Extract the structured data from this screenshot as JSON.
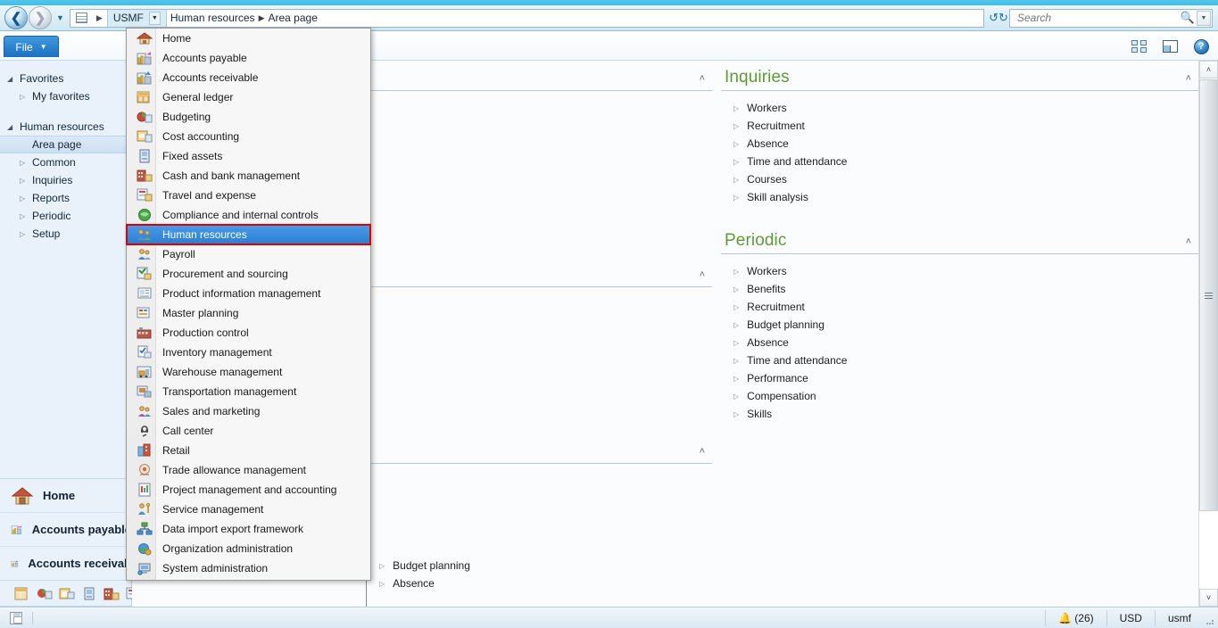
{
  "titlebar": {
    "color": "#3fbde5"
  },
  "addressbar": {
    "company": "USMF",
    "breadcrumb": [
      "Human resources",
      "Area page"
    ],
    "separator": "▶",
    "back_arrow": "❮",
    "forward_arrow": "❯",
    "recent_caret": "▼",
    "refresh_icon": "refresh-icon",
    "grid_icon": "grid-icon"
  },
  "search": {
    "placeholder": "Search",
    "value": "",
    "magnifier": "⚲",
    "caret": "▼"
  },
  "ribbon": {
    "file_label": "File",
    "file_caret": "▼",
    "right_icons": [
      "layouts-icon",
      "pane-layout-icon",
      "help-icon"
    ],
    "help_glyph": "?"
  },
  "sidebar": {
    "groups": [
      {
        "name": "Favorites",
        "expander": "◢",
        "items": [
          {
            "label": "My favorites",
            "expander": "▷"
          }
        ]
      },
      {
        "name": "Human resources",
        "expander": "◢",
        "items": [
          {
            "label": "Area page",
            "expander": "",
            "selected": true
          },
          {
            "label": "Common",
            "expander": "▷"
          },
          {
            "label": "Inquiries",
            "expander": "▷"
          },
          {
            "label": "Reports",
            "expander": "▷"
          },
          {
            "label": "Periodic",
            "expander": "▷"
          },
          {
            "label": "Setup",
            "expander": "▷"
          }
        ]
      }
    ],
    "places": [
      {
        "label": "Home",
        "icon": "home-icon"
      },
      {
        "label": "Accounts payable",
        "icon": "accounts-payable-icon"
      },
      {
        "label": "Accounts receivab",
        "icon": "accounts-receivable-icon"
      }
    ],
    "mini_icons": [
      "general-ledger-icon",
      "budgeting-icon",
      "cost-accounting-icon",
      "fixed-assets-icon",
      "cash-bank-icon",
      "travel-expense-icon",
      "compliance-icon",
      "human-resources-icon"
    ],
    "mini_more": "»"
  },
  "module_menu": {
    "items": [
      {
        "label": "Home",
        "icon": "home-icon"
      },
      {
        "label": "Accounts payable",
        "icon": "accounts-payable-icon"
      },
      {
        "label": "Accounts receivable",
        "icon": "accounts-receivable-icon"
      },
      {
        "label": "General ledger",
        "icon": "general-ledger-icon"
      },
      {
        "label": "Budgeting",
        "icon": "budgeting-icon"
      },
      {
        "label": "Cost accounting",
        "icon": "cost-accounting-icon"
      },
      {
        "label": "Fixed assets",
        "icon": "fixed-assets-icon"
      },
      {
        "label": "Cash and bank management",
        "icon": "cash-bank-icon"
      },
      {
        "label": "Travel and expense",
        "icon": "travel-expense-icon"
      },
      {
        "label": "Compliance and internal controls",
        "icon": "compliance-icon"
      },
      {
        "label": "Human resources",
        "icon": "human-resources-icon",
        "active": true
      },
      {
        "label": "Payroll",
        "icon": "payroll-icon"
      },
      {
        "label": "Procurement and sourcing",
        "icon": "procurement-icon"
      },
      {
        "label": "Product information management",
        "icon": "product-info-icon"
      },
      {
        "label": "Master planning",
        "icon": "master-planning-icon"
      },
      {
        "label": "Production control",
        "icon": "production-control-icon"
      },
      {
        "label": "Inventory management",
        "icon": "inventory-icon"
      },
      {
        "label": "Warehouse management",
        "icon": "warehouse-icon"
      },
      {
        "label": "Transportation management",
        "icon": "transportation-icon"
      },
      {
        "label": "Sales and marketing",
        "icon": "sales-marketing-icon"
      },
      {
        "label": "Call center",
        "icon": "call-center-icon"
      },
      {
        "label": "Retail",
        "icon": "retail-icon"
      },
      {
        "label": "Trade allowance management",
        "icon": "trade-allowance-icon"
      },
      {
        "label": "Project management and accounting",
        "icon": "project-management-icon"
      },
      {
        "label": "Service management",
        "icon": "service-management-icon"
      },
      {
        "label": "Data import export framework",
        "icon": "data-import-export-icon"
      },
      {
        "label": "Organization administration",
        "icon": "organization-admin-icon"
      },
      {
        "label": "System administration",
        "icon": "system-admin-icon"
      }
    ],
    "highlight_color": "#e00000",
    "selected_bg": "#2a7fd4"
  },
  "main": {
    "collapse_chevron": "˄",
    "panels": [
      {
        "title": "Inquiries",
        "title_color": "#5e9c33",
        "links": [
          "Workers",
          "Recruitment",
          "Absence",
          "Time and attendance",
          "Courses",
          "Skill analysis"
        ]
      },
      {
        "title": "Periodic",
        "title_color": "#5e9c33",
        "links": [
          "Workers",
          "Benefits",
          "Recruitment",
          "Budget planning",
          "Absence",
          "Time and attendance",
          "Performance",
          "Compensation",
          "Skills"
        ]
      }
    ],
    "link_expander": "▷",
    "obscured_links": [
      "Budget planning",
      "Absence"
    ]
  },
  "scrollbar": {
    "up_arrow": "˄",
    "down_arrow": "˅"
  },
  "statusbar": {
    "notification_icon": "bell-icon",
    "notification_count": "(26)",
    "currency": "USD",
    "company": "usmf",
    "save_icon": "save-icon"
  }
}
